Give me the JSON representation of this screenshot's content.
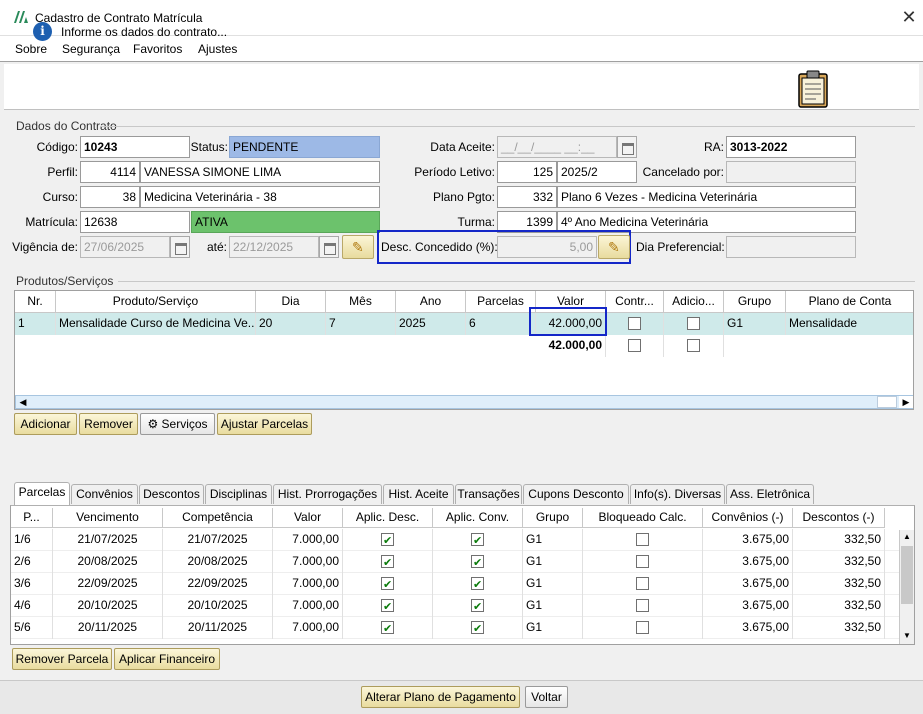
{
  "window": {
    "title": "Cadastro de Contrato Matrícula"
  },
  "menu": [
    {
      "label": "Sobre"
    },
    {
      "label": "Segurança"
    },
    {
      "label": "Favoritos"
    },
    {
      "label": "Ajustes"
    }
  ],
  "info": {
    "text": "Informe os dados do contrato..."
  },
  "contract": {
    "section": "Dados do Contrato",
    "codigo_label": "Código:",
    "codigo": "10243",
    "status_label": "Status:",
    "status": "PENDENTE",
    "data_aceite_label": "Data Aceite:",
    "data_aceite": "__/__/____ __:__",
    "ra_label": "RA:",
    "ra": "3013-2022",
    "perfil_label": "Perfil:",
    "perfil_id": "4114",
    "perfil_nome": "VANESSA SIMONE LIMA",
    "periodo_label": "Período Letivo:",
    "periodo_id": "125",
    "periodo": "2025/2",
    "cancelado_label": "Cancelado por:",
    "cancelado": "",
    "curso_label": "Curso:",
    "curso_id": "38",
    "curso": "Medicina Veterinária - 38",
    "plano_label": "Plano Pgto:",
    "plano_id": "332",
    "plano": "Plano 6 Vezes - Medicina Veterinária",
    "matricula_label": "Matrícula:",
    "matricula": "12638",
    "matricula_status": "ATIVA",
    "turma_label": "Turma:",
    "turma_id": "1399",
    "turma": "4º Ano Medicina Veterinária",
    "vigencia_label": "Vigência de:",
    "vigencia_de": "27/06/2025",
    "ate_label": "até:",
    "vigencia_ate": "22/12/2025",
    "desc_label": "Desc. Concedido (%):",
    "desc": "5,00",
    "dia_pref_label": "Dia Preferencial:",
    "dia_pref": ""
  },
  "products": {
    "section": "Produtos/Serviços",
    "headers": [
      "Nr.",
      "Produto/Serviço",
      "Dia",
      "Mês",
      "Ano",
      "Parcelas",
      "Valor",
      "Contr...",
      "Adicio...",
      "Grupo",
      "Plano de Conta"
    ],
    "row": {
      "nr": "1",
      "produto": "Mensalidade Curso de Medicina Ve...",
      "dia": "20",
      "mes": "7",
      "ano": "2025",
      "parcelas": "6",
      "valor": "42.000,00",
      "grupo": "G1",
      "plano": "Mensalidade"
    },
    "total": "42.000,00",
    "buttons": {
      "adicionar": "Adicionar",
      "remover": "Remover",
      "servicos": "Serviços",
      "ajustar": "Ajustar Parcelas"
    }
  },
  "tabs": [
    {
      "label": "Parcelas"
    },
    {
      "label": "Convênios"
    },
    {
      "label": "Descontos"
    },
    {
      "label": "Disciplinas"
    },
    {
      "label": "Hist. Prorrogações"
    },
    {
      "label": "Hist. Aceite"
    },
    {
      "label": "Transações"
    },
    {
      "label": "Cupons Desconto"
    },
    {
      "label": "Info(s). Diversas"
    },
    {
      "label": "Ass. Eletrônica"
    }
  ],
  "parcelas": {
    "headers": [
      "P...",
      "Vencimento",
      "Competência",
      "Valor",
      "Aplic. Desc.",
      "Aplic. Conv.",
      "Grupo",
      "Bloqueado Calc.",
      "Convênios (-)",
      "Descontos (-)"
    ],
    "rows": [
      {
        "p": "1/6",
        "venc": "21/07/2025",
        "comp": "21/07/2025",
        "valor": "7.000,00",
        "grupo": "G1",
        "conv": "3.675,00",
        "desc": "332,50"
      },
      {
        "p": "2/6",
        "venc": "20/08/2025",
        "comp": "20/08/2025",
        "valor": "7.000,00",
        "grupo": "G1",
        "conv": "3.675,00",
        "desc": "332,50"
      },
      {
        "p": "3/6",
        "venc": "22/09/2025",
        "comp": "22/09/2025",
        "valor": "7.000,00",
        "grupo": "G1",
        "conv": "3.675,00",
        "desc": "332,50"
      },
      {
        "p": "4/6",
        "venc": "20/10/2025",
        "comp": "20/10/2025",
        "valor": "7.000,00",
        "grupo": "G1",
        "conv": "3.675,00",
        "desc": "332,50"
      },
      {
        "p": "5/6",
        "venc": "20/11/2025",
        "comp": "20/11/2025",
        "valor": "7.000,00",
        "grupo": "G1",
        "conv": "3.675,00",
        "desc": "332,50"
      }
    ],
    "buttons": {
      "remover": "Remover Parcela",
      "aplicar": "Aplicar Financeiro"
    }
  },
  "footer": {
    "alterar": "Alterar Plano de Pagamento",
    "voltar": "Voltar"
  },
  "colors": {
    "status_bg": "#9db9e6",
    "ativa_bg": "#6cc26c",
    "highlight": "#1427c8",
    "row_selected": "#cfeaea"
  }
}
